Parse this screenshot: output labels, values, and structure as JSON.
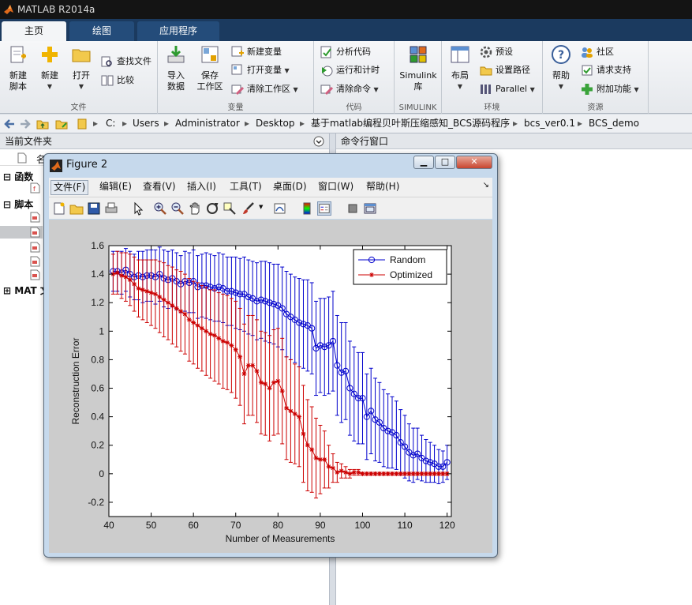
{
  "app": {
    "title": "MATLAB R2014a"
  },
  "ribbon_tabs": [
    "主页",
    "绘图",
    "应用程序"
  ],
  "ribbon": {
    "file_group": {
      "title": "文件",
      "new_script": [
        "新建",
        "脚本"
      ],
      "new": "新建",
      "open": "打开",
      "find_files": "查找文件",
      "compare": "比较"
    },
    "variable_group": {
      "title": "变量",
      "import": [
        "导入",
        "数据"
      ],
      "save_workspace": [
        "保存",
        "工作区"
      ],
      "new_variable": "新建变量",
      "open_variable": "打开变量",
      "clear_workspace": "清除工作区"
    },
    "code_group": {
      "title": "代码",
      "analyze": "分析代码",
      "run_time": "运行和计时",
      "clear_commands": "清除命令"
    },
    "simulink_group": {
      "title": "SIMULINK",
      "library": [
        "Simulink",
        "库"
      ]
    },
    "env_group": {
      "title": "环境",
      "layout": "布局",
      "preferences": "预设",
      "set_path": "设置路径",
      "parallel": "Parallel"
    },
    "resources_group": {
      "title": "资源",
      "help": "帮助",
      "community": "社区",
      "request_support": "请求支持",
      "addons": "附加功能"
    }
  },
  "address": {
    "path": [
      "C:",
      "Users",
      "Administrator",
      "Desktop",
      "基于matlab编程贝叶斯压缩感知_BCS源码程序",
      "bcs_ver0.1",
      "BCS_demo"
    ]
  },
  "left_panel": {
    "title": "当前文件夹",
    "col_name": "名",
    "sections": [
      "函数",
      "脚本",
      "MAT 文"
    ]
  },
  "right_panel": {
    "title": "命令行窗口"
  },
  "figure": {
    "title": "Figure 2",
    "menus": [
      "文件(F)",
      "编辑(E)",
      "查看(V)",
      "插入(I)",
      "工具(T)",
      "桌面(D)",
      "窗口(W)",
      "帮助(H)"
    ]
  },
  "colors": {
    "random": "#0000cc",
    "optimized": "#cc0000"
  },
  "chart_data": {
    "type": "line",
    "xlabel": "Number of Measurements",
    "ylabel": "Reconstruction Error",
    "xlim": [
      40,
      121
    ],
    "ylim": [
      -0.3,
      1.6
    ],
    "xticks": [
      40,
      50,
      60,
      70,
      80,
      90,
      100,
      110,
      120
    ],
    "yticks": [
      -0.2,
      0,
      0.2,
      0.4,
      0.6,
      0.8,
      1,
      1.2,
      1.4,
      1.6
    ],
    "legend_position": "top-right",
    "x": [
      41,
      42,
      43,
      44,
      45,
      46,
      47,
      48,
      49,
      50,
      51,
      52,
      53,
      54,
      55,
      56,
      57,
      58,
      59,
      60,
      61,
      62,
      63,
      64,
      65,
      66,
      67,
      68,
      69,
      70,
      71,
      72,
      73,
      74,
      75,
      76,
      77,
      78,
      79,
      80,
      81,
      82,
      83,
      84,
      85,
      86,
      87,
      88,
      89,
      90,
      91,
      92,
      93,
      94,
      95,
      96,
      97,
      98,
      99,
      100,
      101,
      102,
      103,
      104,
      105,
      106,
      107,
      108,
      109,
      110,
      111,
      112,
      113,
      114,
      115,
      116,
      117,
      118,
      119,
      120
    ],
    "series": [
      {
        "name": "Random",
        "marker": "o",
        "values": [
          1.42,
          1.42,
          1.41,
          1.43,
          1.4,
          1.38,
          1.39,
          1.38,
          1.39,
          1.39,
          1.38,
          1.4,
          1.37,
          1.36,
          1.37,
          1.35,
          1.33,
          1.35,
          1.34,
          1.35,
          1.31,
          1.32,
          1.32,
          1.31,
          1.3,
          1.31,
          1.3,
          1.28,
          1.28,
          1.27,
          1.26,
          1.26,
          1.24,
          1.23,
          1.21,
          1.22,
          1.21,
          1.2,
          1.19,
          1.18,
          1.16,
          1.12,
          1.1,
          1.08,
          1.06,
          1.05,
          1.04,
          1.02,
          0.88,
          0.9,
          0.89,
          0.9,
          0.93,
          0.76,
          0.71,
          0.72,
          0.6,
          0.56,
          0.53,
          0.53,
          0.4,
          0.44,
          0.38,
          0.36,
          0.32,
          0.3,
          0.29,
          0.27,
          0.22,
          0.19,
          0.15,
          0.13,
          0.14,
          0.11,
          0.09,
          0.08,
          0.07,
          0.05,
          0.05,
          0.08
        ],
        "err": [
          0.14,
          0.14,
          0.15,
          0.15,
          0.16,
          0.16,
          0.17,
          0.18,
          0.18,
          0.18,
          0.19,
          0.19,
          0.2,
          0.2,
          0.2,
          0.2,
          0.2,
          0.21,
          0.21,
          0.22,
          0.22,
          0.22,
          0.23,
          0.23,
          0.23,
          0.24,
          0.24,
          0.24,
          0.24,
          0.25,
          0.25,
          0.26,
          0.26,
          0.26,
          0.27,
          0.27,
          0.28,
          0.28,
          0.28,
          0.29,
          0.29,
          0.3,
          0.3,
          0.3,
          0.31,
          0.31,
          0.32,
          0.32,
          0.33,
          0.33,
          0.34,
          0.34,
          0.35,
          0.35,
          0.35,
          0.34,
          0.33,
          0.33,
          0.32,
          0.32,
          0.3,
          0.3,
          0.29,
          0.28,
          0.27,
          0.26,
          0.25,
          0.24,
          0.23,
          0.22,
          0.2,
          0.19,
          0.18,
          0.16,
          0.15,
          0.14,
          0.13,
          0.12,
          0.11,
          0.12
        ]
      },
      {
        "name": "Optimized",
        "marker": "*",
        "values": [
          1.4,
          1.41,
          1.39,
          1.38,
          1.36,
          1.33,
          1.3,
          1.29,
          1.28,
          1.27,
          1.26,
          1.24,
          1.22,
          1.2,
          1.18,
          1.16,
          1.14,
          1.12,
          1.08,
          1.06,
          1.04,
          1.02,
          1.0,
          0.98,
          0.97,
          0.95,
          0.93,
          0.92,
          0.9,
          0.87,
          0.82,
          0.7,
          0.76,
          0.76,
          0.72,
          0.64,
          0.63,
          0.6,
          0.64,
          0.65,
          0.58,
          0.46,
          0.44,
          0.42,
          0.4,
          0.28,
          0.2,
          0.17,
          0.11,
          0.1,
          0.1,
          0.05,
          0.04,
          0.01,
          0.02,
          0.01,
          0.0,
          0.01,
          0.01,
          0.0,
          0.0,
          0.0,
          0.0,
          0.0,
          0.0,
          0.0,
          0.0,
          0.0,
          0.0,
          0.0,
          0.0,
          0.0,
          0.0,
          0.0,
          0.0,
          0.0,
          0.0,
          0.0,
          0.0,
          0.0
        ],
        "err": [
          0.14,
          0.15,
          0.16,
          0.17,
          0.18,
          0.19,
          0.2,
          0.21,
          0.22,
          0.23,
          0.24,
          0.25,
          0.26,
          0.26,
          0.27,
          0.27,
          0.28,
          0.28,
          0.29,
          0.29,
          0.3,
          0.3,
          0.31,
          0.31,
          0.32,
          0.32,
          0.33,
          0.33,
          0.33,
          0.34,
          0.34,
          0.35,
          0.35,
          0.35,
          0.36,
          0.36,
          0.36,
          0.37,
          0.37,
          0.37,
          0.37,
          0.36,
          0.36,
          0.35,
          0.35,
          0.34,
          0.32,
          0.3,
          0.28,
          0.24,
          0.2,
          0.15,
          0.1,
          0.07,
          0.05,
          0.04,
          0.03,
          0.02,
          0.02,
          0.01,
          0.01,
          0.01,
          0.01,
          0.01,
          0.01,
          0.01,
          0.01,
          0.01,
          0.01,
          0.01,
          0.01,
          0.01,
          0.01,
          0.01,
          0.01,
          0.01,
          0.01,
          0.01,
          0.01,
          0.01
        ]
      }
    ]
  }
}
